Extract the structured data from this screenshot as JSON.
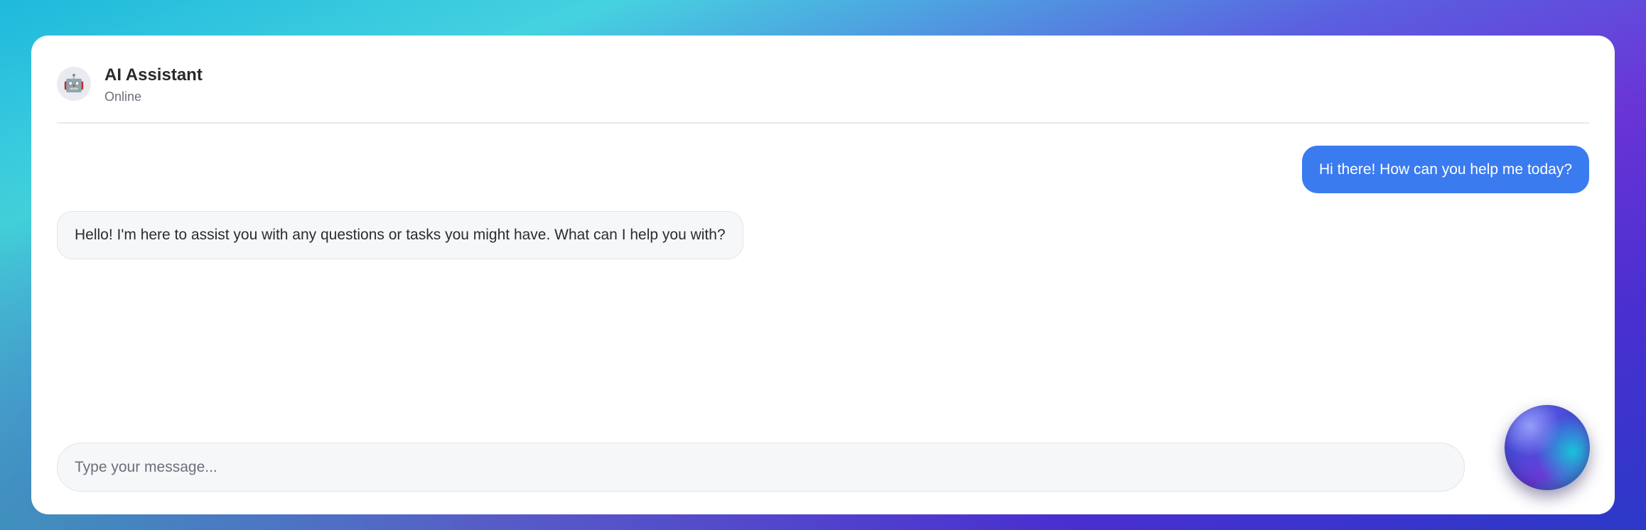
{
  "header": {
    "avatar_icon": "robot-icon",
    "avatar_glyph": "🤖",
    "title": "AI Assistant",
    "status": "Online"
  },
  "messages": [
    {
      "role": "user",
      "text": "Hi there! How can you help me today?"
    },
    {
      "role": "assistant",
      "text": "Hello! I'm here to assist you with any questions or tasks you might have. What can I help you with?"
    }
  ],
  "composer": {
    "placeholder": "Type your message...",
    "value": ""
  },
  "orb_button": {
    "icon": "gradient-orb-icon"
  },
  "colors": {
    "user_bubble": "#3b7bf0",
    "bot_bubble": "#f6f7f9",
    "card": "#ffffff"
  }
}
